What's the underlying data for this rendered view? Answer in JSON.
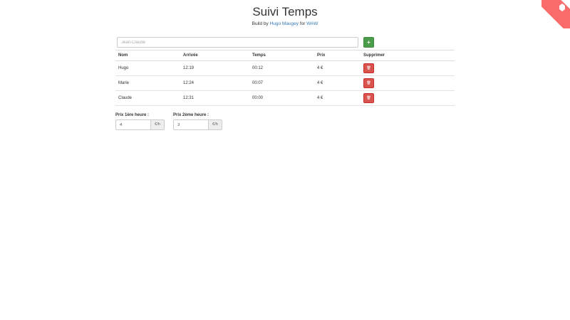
{
  "header": {
    "title": "Suivi Temps",
    "subtitle_prefix": "Build by ",
    "author_link": "Hugo Maugey",
    "subtitle_middle": " for ",
    "org_link": "WAW"
  },
  "form": {
    "name_placeholder": "Jean-Claude",
    "add_button": "+"
  },
  "table": {
    "headers": [
      "Nom",
      "Arrivée",
      "Temps",
      "Prix",
      "Supprimer"
    ],
    "rows": [
      {
        "nom": "Hugo",
        "arrivee": "12:19",
        "temps": "00:12",
        "prix": "4 €",
        "delete": "🗑"
      },
      {
        "nom": "Marie",
        "arrivee": "12:24",
        "temps": "00:07",
        "prix": "4 €",
        "delete": "🗑"
      },
      {
        "nom": "Claude",
        "arrivee": "12:31",
        "temps": "00:00",
        "prix": "4 €",
        "delete": "🗑"
      }
    ]
  },
  "pricing": {
    "first_label": "Prix 1ère heure :",
    "first_value": "4",
    "second_label": "Prix 2ème heure :",
    "second_value": "3",
    "unit": "€/h"
  },
  "colors": {
    "accent_link": "#337ab7",
    "add_button": "#4a9c4a",
    "delete_button": "#d9534f",
    "corner_ribbon": "#fa6b6b"
  },
  "icons": {
    "delete": "trash-icon",
    "corner": "github-fork-icon"
  }
}
